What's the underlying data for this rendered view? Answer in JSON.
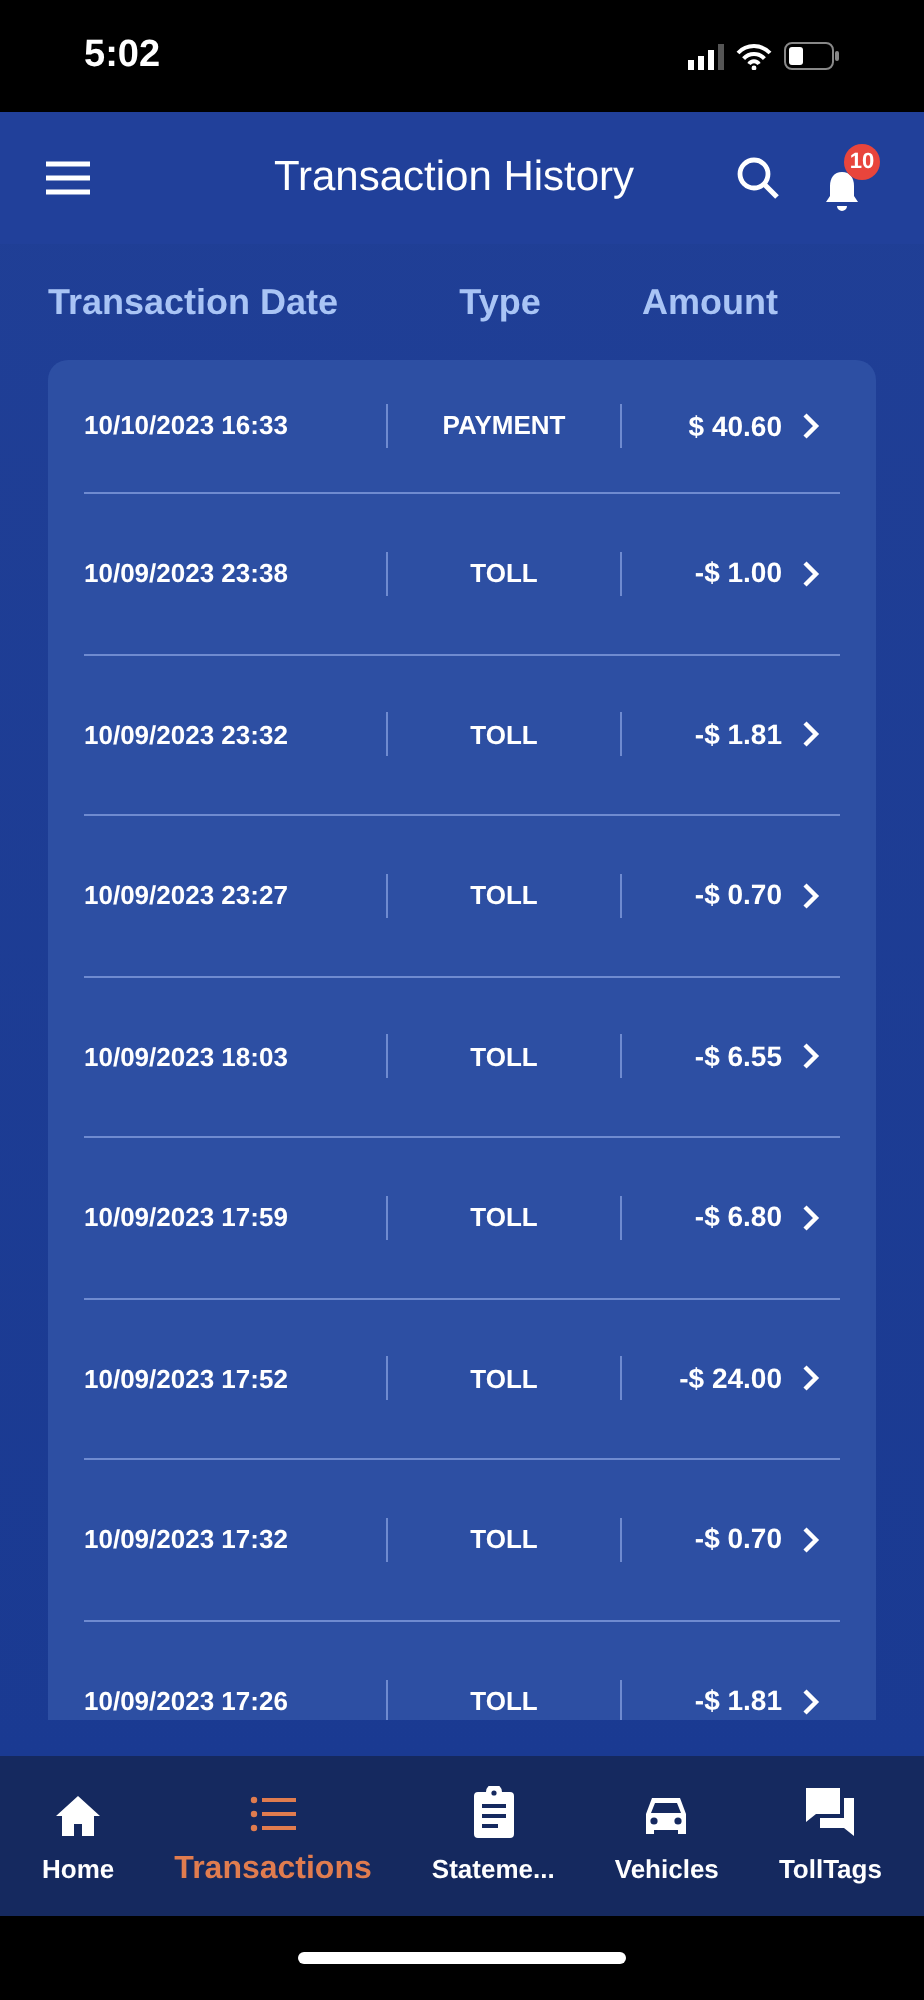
{
  "status_bar": {
    "time": "5:02"
  },
  "header": {
    "title": "Transaction History",
    "notification_count": "10"
  },
  "table": {
    "columns": [
      "Transaction Date",
      "Type",
      "Amount"
    ],
    "rows": [
      {
        "date": "10/10/2023 16:33",
        "type": "PAYMENT",
        "amount": "$ 40.60"
      },
      {
        "date": "10/09/2023 23:38",
        "type": "TOLL",
        "amount": "-$ 1.00"
      },
      {
        "date": "10/09/2023 23:32",
        "type": "TOLL",
        "amount": "-$ 1.81"
      },
      {
        "date": "10/09/2023 23:27",
        "type": "TOLL",
        "amount": "-$ 0.70"
      },
      {
        "date": "10/09/2023 18:03",
        "type": "TOLL",
        "amount": "-$ 6.55"
      },
      {
        "date": "10/09/2023 17:59",
        "type": "TOLL",
        "amount": "-$ 6.80"
      },
      {
        "date": "10/09/2023 17:52",
        "type": "TOLL",
        "amount": "-$ 24.00"
      },
      {
        "date": "10/09/2023 17:32",
        "type": "TOLL",
        "amount": "-$ 0.70"
      },
      {
        "date": "10/09/2023 17:26",
        "type": "TOLL",
        "amount": "-$ 1.81"
      }
    ]
  },
  "tab_bar": [
    {
      "label": "Home",
      "kind": "home",
      "selected": false
    },
    {
      "label": "Transactions",
      "kind": "list",
      "selected": true
    },
    {
      "label": "Stateme...",
      "kind": "clipboard",
      "selected": false
    },
    {
      "label": "Vehicles",
      "kind": "car",
      "selected": false
    },
    {
      "label": "TollTags",
      "kind": "chat",
      "selected": false
    }
  ]
}
